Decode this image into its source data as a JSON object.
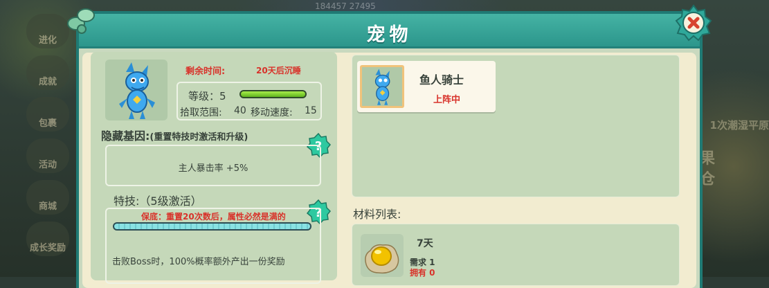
{
  "panel": {
    "title": "宠物"
  },
  "background": {
    "side_menu": [
      "进化",
      "成就",
      "包裹",
      "活动",
      "商城",
      "成长奖励"
    ],
    "right_text": "1次潮湿平原",
    "right_big": "果仓",
    "top_numbers": "184457   27495"
  },
  "pet": {
    "remaining_time_label": "剩余时间:",
    "remaining_time_value": "20天后沉睡",
    "level_label": "等级：5",
    "level_progress": 1.0,
    "pickup_range_label": "拾取范围:",
    "pickup_range_value": "40",
    "move_speed_label": "移动速度:",
    "move_speed_value": "15"
  },
  "hidden_gene": {
    "title": "隐藏基因:",
    "note": "(重置特技时激活和升级)",
    "effect": "主人暴击率 +5%"
  },
  "skill": {
    "title": "特技:（5级激活）",
    "guarantee": "保底：重置20次数后，属性必然是满的",
    "progress": 1.0,
    "description": "击败Boss时，100%概率额外产出一份奖励"
  },
  "pet_list": [
    {
      "name": "鱼人骑士",
      "status": "上阵中"
    }
  ],
  "materials": {
    "title": "材料列表:",
    "items": [
      {
        "duration": "7天",
        "need": "需求 1",
        "own": "拥有 0"
      }
    ]
  },
  "colors": {
    "header": "#2a948a",
    "accent_red": "#d8322a",
    "level_bar": "#5fb41e",
    "skill_bar": "#89e2e3",
    "help_button": "#2ec9a0"
  },
  "icons": {
    "close": "close-icon",
    "help": "question-icon",
    "material": "gold-egg-icon"
  }
}
